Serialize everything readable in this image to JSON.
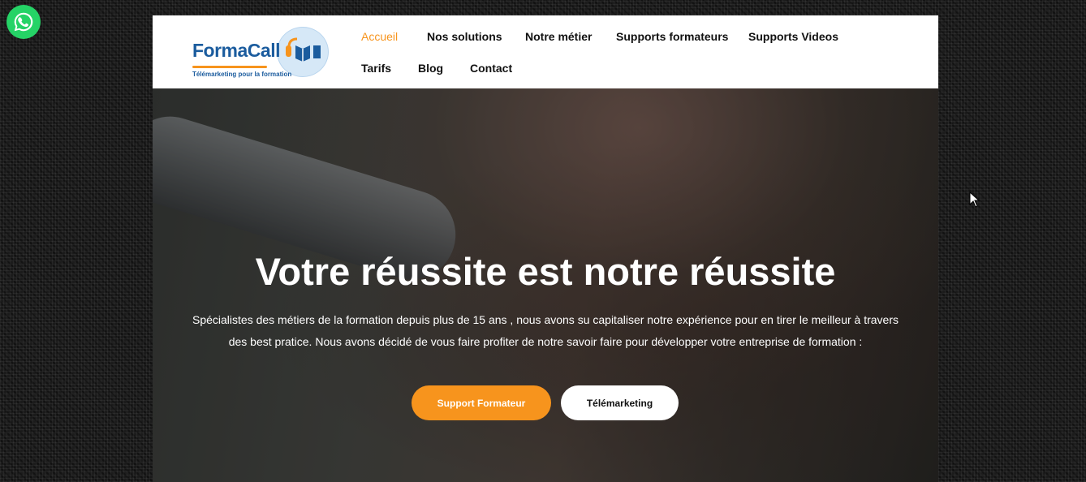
{
  "whatsapp": {
    "icon": "whatsapp-icon",
    "color": "#25d366"
  },
  "logo": {
    "brand": "FormaCall",
    "tagline": "Télémarketing pour la formation",
    "colors": {
      "blue": "#1b5c9e",
      "orange": "#f7941d"
    }
  },
  "nav": {
    "items": [
      {
        "label": "Accueil",
        "active": true
      },
      {
        "label": "Nos solutions"
      },
      {
        "label": "Notre métier"
      },
      {
        "label": "Supports formateurs"
      },
      {
        "label": "Supports Videos"
      },
      {
        "label": "Tarifs"
      },
      {
        "label": "Blog"
      },
      {
        "label": "Contact"
      }
    ],
    "active_color": "#f7941d"
  },
  "hero": {
    "title": "Votre réussite est notre réussite",
    "text": "Spécialistes des métiers de la formation depuis plus de 15 ans , nous avons su capitaliser notre expérience pour en tirer le meilleur à travers des best pratice. Nous avons décidé de vous faire profiter de notre savoir faire pour développer votre entreprise de formation :",
    "buttons": {
      "primary": "Support Formateur",
      "secondary": "Télémarketing"
    }
  }
}
